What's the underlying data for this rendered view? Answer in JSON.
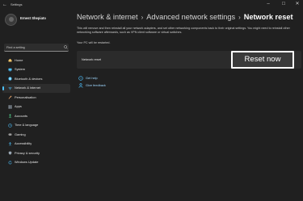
{
  "window": {
    "app_title": "Settings"
  },
  "profile": {
    "name": "Ernest Shepiato"
  },
  "search": {
    "placeholder": "Find a setting"
  },
  "sidebar": {
    "items": [
      {
        "label": "Home",
        "icon": "home-icon",
        "color": "#f0c46a"
      },
      {
        "label": "System",
        "icon": "monitor-icon",
        "color": "#4cc2ff"
      },
      {
        "label": "Bluetooth & devices",
        "icon": "bluetooth-icon",
        "color": "#4cc2ff"
      },
      {
        "label": "Network & internet",
        "icon": "wifi-icon",
        "color": "#4cc2ff",
        "active": true
      },
      {
        "label": "Personalisation",
        "icon": "brush-icon",
        "color": "#e8a36a"
      },
      {
        "label": "Apps",
        "icon": "apps-icon",
        "color": "#9aa7b4"
      },
      {
        "label": "Accounts",
        "icon": "person-icon",
        "color": "#4fd18b"
      },
      {
        "label": "Time & language",
        "icon": "globe-clock-icon",
        "color": "#4cc2ff"
      },
      {
        "label": "Gaming",
        "icon": "gamepad-icon",
        "color": "#b9b9b9"
      },
      {
        "label": "Accessibility",
        "icon": "accessibility-icon",
        "color": "#4cc2ff"
      },
      {
        "label": "Privacy & security",
        "icon": "shield-icon",
        "color": "#9aa7b4"
      },
      {
        "label": "Windows Update",
        "icon": "update-icon",
        "color": "#4cc2ff"
      }
    ]
  },
  "breadcrumb": {
    "items": [
      "Network & internet",
      "Advanced network settings"
    ],
    "current": "Network reset",
    "separator": "›"
  },
  "main": {
    "description": "This will remove and then reinstall all your network adapters, and set other networking components back to their original settings. You might need to reinstall other networking software afterwards, such as VPN client software or virtual switches.",
    "restart_note": "Your PC will be restarted.",
    "card_label": "Network reset",
    "reset_button": "Reset now",
    "links": {
      "help": "Get help",
      "feedback": "Give feedback"
    }
  },
  "colors": {
    "accent": "#4cc2ff",
    "link": "#9fd8ff",
    "background": "#202020",
    "card": "#2b2b2b"
  }
}
